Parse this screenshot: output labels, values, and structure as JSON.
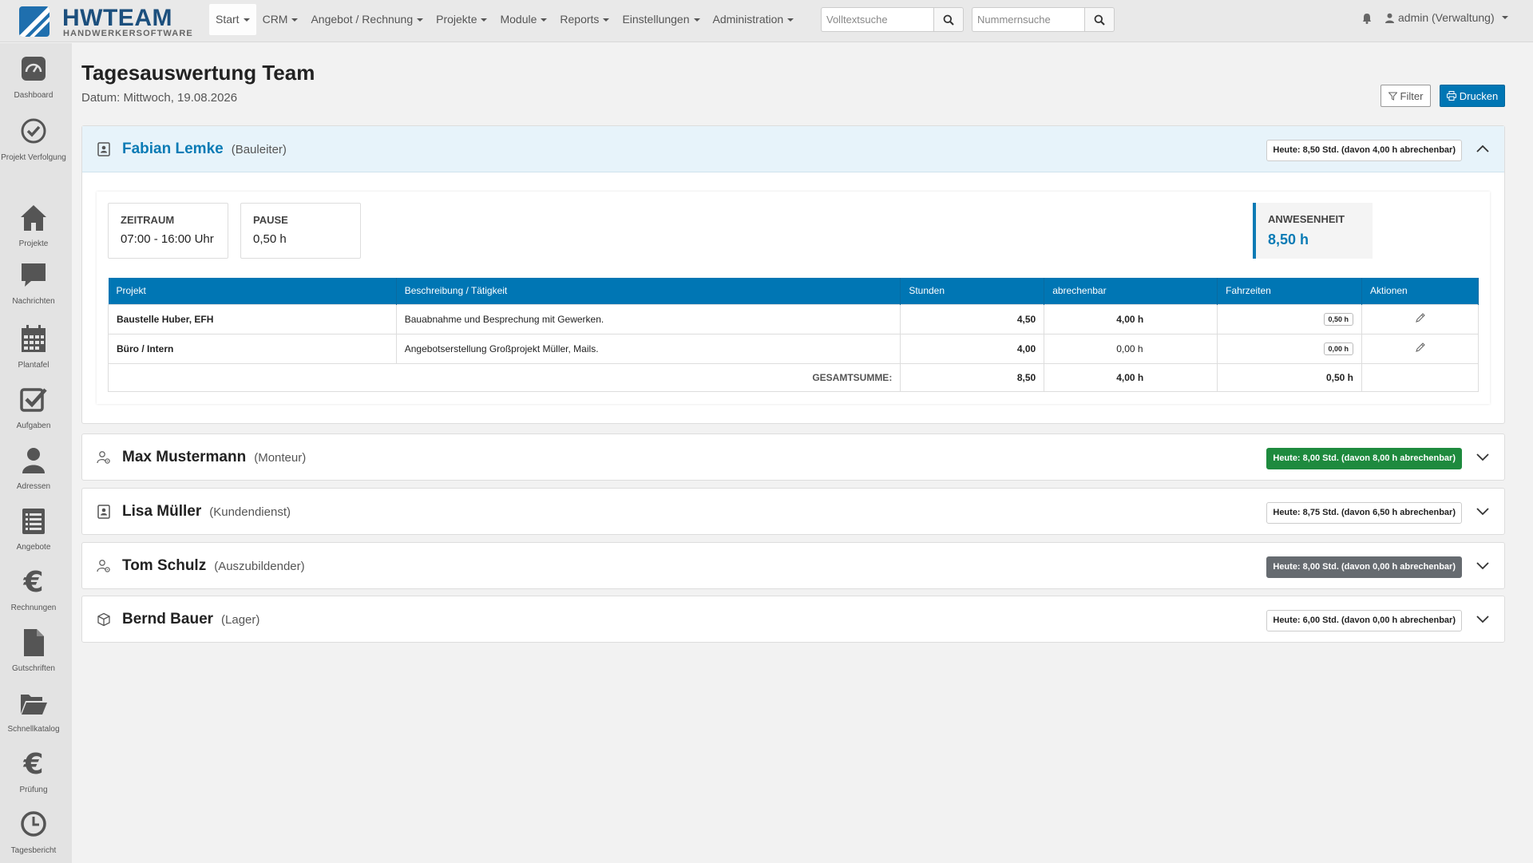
{
  "brand": {
    "title": "HWTEAM",
    "subtitle": "HANDWERKERSOFTWARE"
  },
  "nav": [
    "Start",
    "CRM",
    "Angebot / Rechnung",
    "Projekte",
    "Module",
    "Reports",
    "Einstellungen",
    "Administration"
  ],
  "search": {
    "fulltext_placeholder": "Volltextsuche",
    "number_placeholder": "Nummernsuche"
  },
  "user": {
    "label": "admin (Verwaltung)"
  },
  "sidebar": [
    {
      "label": "Dashboard",
      "icon": "dashboard-icon"
    },
    {
      "label": "Projekt Verfolgung",
      "icon": "check-circle-icon"
    },
    {
      "label": "Projekte",
      "icon": "home-icon"
    },
    {
      "label": "Nachrichten",
      "icon": "chat-icon"
    },
    {
      "label": "Plantafel",
      "icon": "calendar-icon"
    },
    {
      "label": "Aufgaben",
      "icon": "task-check-icon"
    },
    {
      "label": "Adressen",
      "icon": "user-icon"
    },
    {
      "label": "Angebote",
      "icon": "list-icon"
    },
    {
      "label": "Rechnungen",
      "icon": "euro-icon"
    },
    {
      "label": "Gutschriften",
      "icon": "file-icon"
    },
    {
      "label": "Schnellkatalog",
      "icon": "folder-open-icon"
    },
    {
      "label": "Prüfung",
      "icon": "euro-icon"
    },
    {
      "label": "Tagesbericht",
      "icon": "clock-icon"
    }
  ],
  "page": {
    "title": "Tagesauswertung Team",
    "date": "Datum: Mittwoch, 19.08.2026",
    "filter_label": "Filter",
    "print_label": "Drucken"
  },
  "employees": [
    {
      "name": "Fabian Lemke",
      "role": "(Bauleiter)",
      "badge": "Heute: 8,50 Std. (davon 4,00 h abrechenbar)",
      "badge_style": "white",
      "icon": "id-card-icon",
      "expanded": true
    },
    {
      "name": "Max Mustermann",
      "role": "(Monteur)",
      "badge": "Heute: 8,00 Std. (davon 8,00 h abrechenbar)",
      "badge_style": "green",
      "icon": "user-gear-icon",
      "expanded": false
    },
    {
      "name": "Lisa Müller",
      "role": "(Kundendienst)",
      "badge": "Heute: 8,75 Std. (davon 6,50 h abrechenbar)",
      "badge_style": "white",
      "icon": "id-card-icon",
      "expanded": false
    },
    {
      "name": "Tom Schulz",
      "role": "(Auszubildender)",
      "badge": "Heute: 8,00 Std. (davon 0,00 h abrechenbar)",
      "badge_style": "gray",
      "icon": "user-gear-icon",
      "expanded": false
    },
    {
      "name": "Bernd Bauer",
      "role": "(Lager)",
      "badge": "Heute: 6,00 Std. (davon 0,00 h abrechenbar)",
      "badge_style": "white",
      "icon": "box-icon",
      "expanded": false
    }
  ],
  "detail": {
    "zeitraum_label": "ZEITRAUM",
    "zeitraum_value": "07:00 - 16:00 Uhr",
    "pause_label": "PAUSE",
    "pause_value": "0,50 h",
    "anwesenheit_label": "ANWESENHEIT",
    "anwesenheit_value": "8,50 h",
    "columns": [
      "Projekt",
      "Beschreibung / Tätigkeit",
      "Stunden",
      "abrechenbar",
      "Fahrzeiten",
      "Aktionen"
    ],
    "rows": [
      {
        "project": "Baustelle Huber, EFH",
        "description": "Bauabnahme und Besprechung mit Gewerken.",
        "hours": "4,50",
        "billable": "4,00 h",
        "travel": "0,50 h"
      },
      {
        "project": "Büro / Intern",
        "description": "Angebotserstellung Großprojekt Müller, Mails.",
        "hours": "4,00",
        "billable": "0,00 h",
        "travel": "0,00 h"
      }
    ],
    "sum_label": "GESAMTSUMME:",
    "sum_hours": "8,50",
    "sum_billable": "4,00 h",
    "sum_travel": "0,50 h"
  },
  "colors": {
    "accent": "#0076b4",
    "green": "#1e8a3e",
    "gray_badge": "#666b70"
  }
}
